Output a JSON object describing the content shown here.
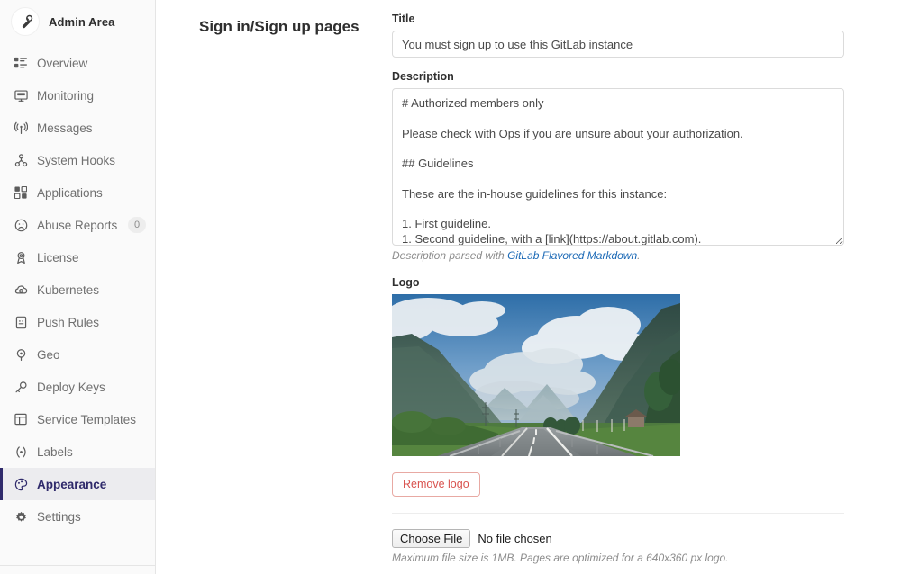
{
  "sidebar": {
    "header": {
      "label": "Admin Area",
      "icon": "wrench-icon"
    },
    "items": [
      {
        "label": "Overview",
        "icon": "overview-icon",
        "active": false,
        "badge": null
      },
      {
        "label": "Monitoring",
        "icon": "monitor-icon",
        "active": false,
        "badge": null
      },
      {
        "label": "Messages",
        "icon": "broadcast-icon",
        "active": false,
        "badge": null
      },
      {
        "label": "System Hooks",
        "icon": "hook-icon",
        "active": false,
        "badge": null
      },
      {
        "label": "Applications",
        "icon": "applications-icon",
        "active": false,
        "badge": null
      },
      {
        "label": "Abuse Reports",
        "icon": "frown-icon",
        "active": false,
        "badge": "0"
      },
      {
        "label": "License",
        "icon": "license-icon",
        "active": false,
        "badge": null
      },
      {
        "label": "Kubernetes",
        "icon": "kubernetes-icon",
        "active": false,
        "badge": null
      },
      {
        "label": "Push Rules",
        "icon": "push-rules-icon",
        "active": false,
        "badge": null
      },
      {
        "label": "Geo",
        "icon": "location-icon",
        "active": false,
        "badge": null
      },
      {
        "label": "Deploy Keys",
        "icon": "key-icon",
        "active": false,
        "badge": null
      },
      {
        "label": "Service Templates",
        "icon": "template-icon",
        "active": false,
        "badge": null
      },
      {
        "label": "Labels",
        "icon": "labels-icon",
        "active": false,
        "badge": null
      },
      {
        "label": "Appearance",
        "icon": "palette-icon",
        "active": true,
        "badge": null
      },
      {
        "label": "Settings",
        "icon": "gear-icon",
        "active": false,
        "badge": null
      }
    ]
  },
  "main": {
    "section_title": "Sign in/Sign up pages",
    "title_field": {
      "label": "Title",
      "value": "You must sign up to use this GitLab instance",
      "placeholder": ""
    },
    "description_field": {
      "label": "Description",
      "value": "# Authorized members only\n\nPlease check with Ops if you are unsure about your authorization.\n\n## Guidelines\n\nThese are the in-house guidelines for this instance:\n\n1. First guideline.\n1. Second guideline, with a [link](https://about.gitlab.com).",
      "placeholder": "",
      "help_prefix": "Description parsed with ",
      "help_link": "GitLab Flavored Markdown",
      "help_suffix": "."
    },
    "logo_field": {
      "label": "Logo",
      "image_alt": "mountain-valley-road-photo",
      "remove_button": "Remove logo",
      "choose_file_button": "Choose File",
      "file_name": "No file chosen",
      "file_help": "Maximum file size is 1MB. Pages are optimized for a 640x360 px logo."
    }
  },
  "colors": {
    "accent": "#2f2a6b",
    "link": "#1b69b6",
    "danger": "#d9534f",
    "sidebar_bg": "#fafafa",
    "active_bg": "#ececef"
  }
}
